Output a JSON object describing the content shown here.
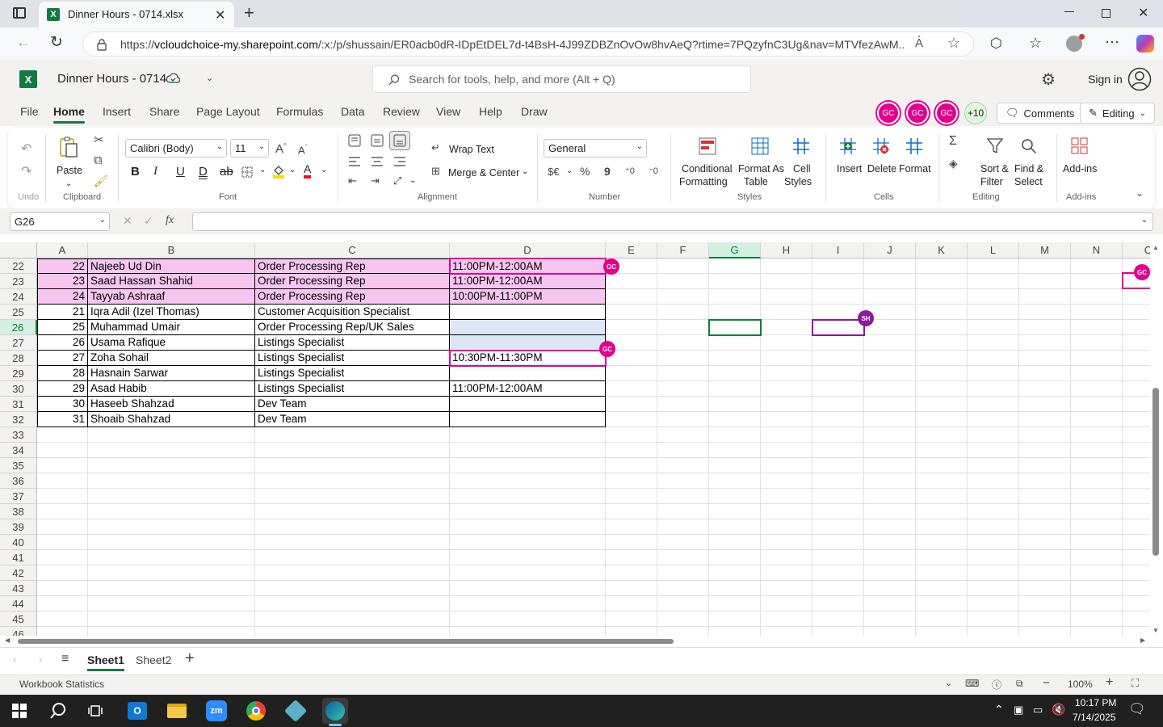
{
  "browser": {
    "tab_title": "Dinner Hours - 0714.xlsx",
    "url_prefix": "https://",
    "url_host": "vcloudchoice-my.sharepoint.com",
    "url_rest": "/:x:/p/shussain/ER0acb0dR-IDpEtDEL7d-t4BsH-4J99ZDBZnOvOw8hvAeQ?rtime=7PQzyfnC3Ug&nav=MTVfezAwM..."
  },
  "app": {
    "doc_title": "Dinner Hours - 0714",
    "search_placeholder": "Search for tools, help, and more (Alt + Q)",
    "sign_in": "Sign in",
    "presence_count": "+10",
    "comments_label": "Comments",
    "editing_label": "Editing",
    "presence_initials": "GC"
  },
  "menu": [
    "File",
    "Home",
    "Insert",
    "Share",
    "Page Layout",
    "Formulas",
    "Data",
    "Review",
    "View",
    "Help",
    "Draw"
  ],
  "ribbon": {
    "undo_group": "Undo",
    "paste": "Paste",
    "clipboard_group": "Clipboard",
    "font_name": "Calibri (Body)",
    "font_size": "11",
    "font_group": "Font",
    "wrap_text": "Wrap Text",
    "merge_center": "Merge & Center",
    "alignment_group": "Alignment",
    "number_format": "General",
    "number_group": "Number",
    "currency_symbol": "$€",
    "percent_symbol": "%",
    "comma_symbol": "9",
    "cond_format_1": "Conditional",
    "cond_format_2": "Formatting",
    "format_table_1": "Format As",
    "format_table_2": "Table",
    "cell_styles_1": "Cell",
    "cell_styles_2": "Styles",
    "styles_group": "Styles",
    "insert": "Insert",
    "delete": "Delete",
    "format": "Format",
    "cells_group": "Cells",
    "sort_filter_1": "Sort &",
    "sort_filter_2": "Filter",
    "find_select_1": "Find &",
    "find_select_2": "Select",
    "editing_group": "Editing",
    "addins": "Add-ins",
    "addins_group": "Add-ins"
  },
  "formula_bar": {
    "name_box": "G26",
    "fx": "fx",
    "value": ""
  },
  "grid": {
    "columns": [
      "A",
      "B",
      "C",
      "D",
      "E",
      "F",
      "G",
      "H",
      "I",
      "J",
      "K",
      "L",
      "M",
      "N",
      "C"
    ],
    "selected_column": "G",
    "row_numbers": [
      "22",
      "23",
      "24",
      "25",
      "26",
      "27",
      "28",
      "29",
      "30",
      "31",
      "32",
      "33",
      "34",
      "35",
      "36",
      "37",
      "38",
      "39",
      "40",
      "41",
      "42",
      "43",
      "44",
      "45",
      "46"
    ],
    "selected_row": "26",
    "rows": [
      {
        "a": "22",
        "b": "Najeeb Ud Din",
        "c": "Order Processing Rep",
        "d": "11:00PM-12:00AM",
        "highlight": "#f7c6f0"
      },
      {
        "a": "23",
        "b": "Saad Hassan Shahid",
        "c": "Order Processing Rep",
        "d": "11:00PM-12:00AM",
        "highlight": "#f7c6f0"
      },
      {
        "a": "24",
        "b": "Tayyab Ashraaf",
        "c": "Order Processing Rep",
        "d": "10:00PM-11:00PM",
        "highlight": "#f7c6f0"
      },
      {
        "a": "21",
        "b": "Iqra Adil (Izel Thomas)",
        "c": "Customer Acquisition Specialist",
        "d": "",
        "highlight": ""
      },
      {
        "a": "25",
        "b": "Muhammad Umair",
        "c": "Order Processing Rep/UK Sales",
        "d": "",
        "highlight": ""
      },
      {
        "a": "26",
        "b": "Usama Rafique",
        "c": "Listings Specialist",
        "d": "",
        "highlight": ""
      },
      {
        "a": "27",
        "b": "Zoha Sohail",
        "c": "Listings Specialist",
        "d": "10:30PM-11:30PM",
        "highlight": ""
      },
      {
        "a": "28",
        "b": "Hasnain Sarwar",
        "c": "Listings Specialist",
        "d": "",
        "highlight": ""
      },
      {
        "a": "29",
        "b": "Asad Habib",
        "c": "Listings Specialist",
        "d": "11:00PM-12:00AM",
        "highlight": ""
      },
      {
        "a": "30",
        "b": "Haseeb Shahzad",
        "c": "Dev Team",
        "d": "",
        "highlight": ""
      },
      {
        "a": "31",
        "b": "Shoaib Shahzad",
        "c": "Dev Team",
        "d": "",
        "highlight": ""
      }
    ],
    "presence_gc": "GC",
    "presence_sh": "SH"
  },
  "sheets": {
    "tabs": [
      "Sheet1",
      "Sheet2"
    ],
    "active": "Sheet1"
  },
  "status": {
    "left": "Workbook Statistics",
    "zoom": "100%"
  },
  "taskbar": {
    "time": "10:17 PM",
    "date": "7/14/2025"
  },
  "colors": {
    "excel_green": "#107c41",
    "presence_gc": "#e3008c",
    "presence_sh": "#8a1a9b",
    "row_highlight": "#f7c6f0",
    "selection_fill": "#dce6f4"
  }
}
